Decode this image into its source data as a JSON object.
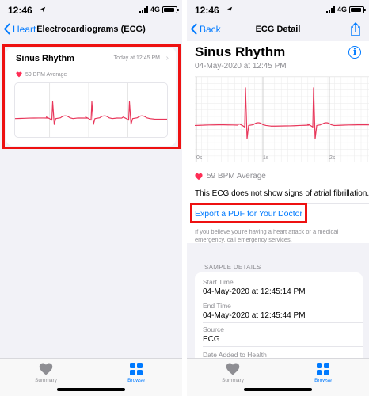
{
  "status_bar": {
    "time": "12:46",
    "network": "4G"
  },
  "left_screen": {
    "back_label": "Heart",
    "title": "Electrocardiograms (ECG)",
    "card": {
      "title": "Sinus Rhythm",
      "date": "Today at 12:45 PM",
      "bpm": "59 BPM Average"
    }
  },
  "right_screen": {
    "back_label": "Back",
    "title": "ECG Detail",
    "heading": "Sinus Rhythm",
    "date": "04-May-2020 at 12:45 PM",
    "time_ticks": [
      "0s",
      "1s",
      "2s"
    ],
    "bpm": "59 BPM Average",
    "result": "This ECG does not show signs of atrial fibrillation.",
    "export_link": "Export a PDF for Your Doctor",
    "emergency_text": "If you believe you're having a heart attack or a medical emergency, call emergency services.",
    "samples": {
      "header": "SAMPLE DETAILS",
      "rows": [
        {
          "label": "Start Time",
          "value": "04-May-2020 at 12:45:14 PM"
        },
        {
          "label": "End Time",
          "value": "04-May-2020 at 12:45:44 PM"
        },
        {
          "label": "Source",
          "value": "ECG"
        },
        {
          "label": "Date Added to Health",
          "value": ""
        }
      ]
    }
  },
  "tab_bar": {
    "summary_label": "Summary",
    "browse_label": "Browse"
  },
  "colors": {
    "accent": "#007aff",
    "ecg_line": "#e8365a",
    "highlight": "#ee1111",
    "heart": "#ff2d55"
  },
  "icons": {
    "back": "chevron-left-icon",
    "share": "share-icon",
    "info": "info-icon",
    "heart": "heart-icon",
    "summary_tab": "heart-icon",
    "browse_tab": "grid-icon"
  }
}
